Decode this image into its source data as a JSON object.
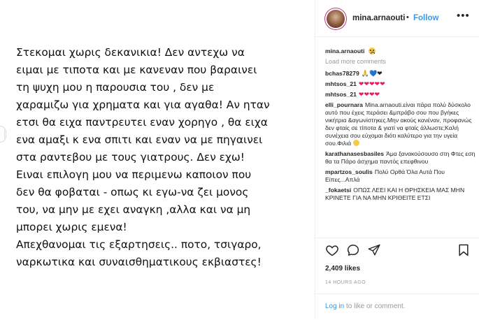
{
  "image_text": [
    "Στεκομαι χωρις δεκανικια! Δεν αντεχω να",
    "ειμαι με τιποτα και με κανεναν που βαραινει",
    "τη ψυχη μου η παρουσια του , δεν με",
    "χαραμιζω για χρηματα και για αγαθα! Αν ηταν",
    "ετσι θα ειχα παντρευτει εναν χορηγο , θα ειχα",
    "ενα αμαξι κ ενα σπιτι και εναν να με πηγαινει",
    "στα ραντεβου με τους γιατρους. Δεν εχω!",
    "Ειναι επιλογη μου να περιμενω καποιον που",
    "δεν θα φοβαται - οπως κι εγω-να ζει μονος",
    "του, να μην με εχει αναγκη ,αλλα και να μη",
    "μπορει χωρις εμενα!",
    "Απεχθανομαι τις εξαρτησεις.. ποτο, τσιγαρο,",
    "ναρκωτικα και συναισθηματικους εκβιαστες!"
  ],
  "header": {
    "username": "mina.arnaouti",
    "dot": "•",
    "follow_label": "Follow",
    "more": "•••"
  },
  "caption": {
    "username": "mina.arnaouti"
  },
  "load_more": "Load more comments",
  "comments": [
    {
      "user": "bchas78279",
      "text": "🙏💙❤"
    },
    {
      "user": "mhtsos_21",
      "text": "❤❤❤❤❤"
    },
    {
      "user": "mhtsos_21",
      "text": "❤❤❤❤"
    },
    {
      "user": "elli_pournara",
      "text": "Mina.arnaouti.είναι πάρα πολύ δύσκολο αυτό που έχεις περάσει &μπράβο σου που βγήκες νικήτρια &αγωνίστηκες.Μην ακούς κανέναν, προφανώς δεν φταίς σε τίποτα & γιατί να φταίς άλλωστε;Καλή συνέχεια σου εύχομαι διότι καλύτερο για την υγεία σου.Φιλιά"
    },
    {
      "user": "karathanasesbasiles",
      "text": "Άμα ξανακούσουσο στη Φτες εση θα τα Πάρο άσχημα παντός επεφθινου"
    },
    {
      "user": "mpartzos_soulis",
      "text": "Πολύ Ορθά Όλα Αυτά Που Είπες...Απλά"
    },
    {
      "user": "_fokaetsi",
      "text": "ΟΠΩΣ ΛΕΕΙ ΚΑΙ Η ΘΡΗΣΚΕΙΑ ΜΑΣ ΜΗΝ ΚΡΙΝΕΤΕ ΓΙΑ ΝΑ ΜΗΝ ΚΡΙΘΕΙΤΕ ΕΤΣΙ"
    }
  ],
  "likes": "2,409 likes",
  "time_ago": "14 HOURS AGO",
  "login": {
    "link": "Log in",
    "rest": " to like or comment."
  },
  "icons": [
    "heart-icon",
    "comment-icon",
    "share-icon",
    "bookmark-icon"
  ],
  "colors": {
    "accent": "#3897f0",
    "text": "#262626",
    "muted": "#999999"
  }
}
